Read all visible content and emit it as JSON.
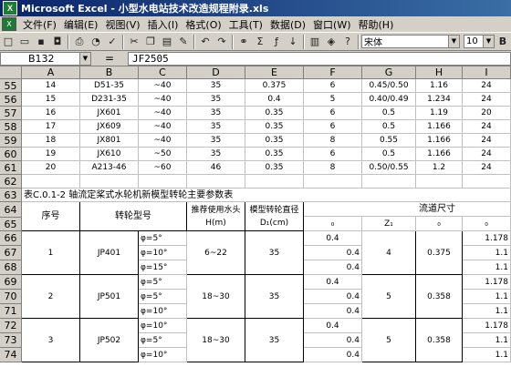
{
  "title": "Microsoft Excel - 小型水电站技术改造规程附录.xls",
  "menu": [
    "文件(F)",
    "编辑(E)",
    "视图(V)",
    "插入(I)",
    "格式(O)",
    "工具(T)",
    "数据(D)",
    "窗口(W)",
    "帮助(H)"
  ],
  "toolbar": {
    "font_name": "宋体",
    "font_size": "10"
  },
  "namebox": "B132",
  "formula_eq": "=",
  "formula_value": "JF2505",
  "columns": [
    "A",
    "B",
    "C",
    "D",
    "E",
    "F",
    "G",
    "H",
    "I"
  ],
  "rows": [
    {
      "n": "55",
      "a": "14",
      "b": "D51-35",
      "c": "~40",
      "d": "35",
      "e": "0.375",
      "f": "6",
      "g": "0.45/0.50",
      "h": "1.16",
      "i": "24"
    },
    {
      "n": "56",
      "a": "15",
      "b": "D231-35",
      "c": "~40",
      "d": "35",
      "e": "0.4",
      "f": "5",
      "g": "0.40/0.49",
      "h": "1.234",
      "i": "24"
    },
    {
      "n": "57",
      "a": "16",
      "b": "JX601",
      "c": "~40",
      "d": "35",
      "e": "0.35",
      "f": "6",
      "g": "0.5",
      "h": "1.19",
      "i": "20"
    },
    {
      "n": "58",
      "a": "17",
      "b": "JX609",
      "c": "~40",
      "d": "35",
      "e": "0.35",
      "f": "6",
      "g": "0.5",
      "h": "1.166",
      "i": "24"
    },
    {
      "n": "59",
      "a": "18",
      "b": "JX801",
      "c": "~40",
      "d": "35",
      "e": "0.35",
      "f": "8",
      "g": "0.55",
      "h": "1.166",
      "i": "24"
    },
    {
      "n": "60",
      "a": "19",
      "b": "JX610",
      "c": "~50",
      "d": "35",
      "e": "0.35",
      "f": "6",
      "g": "0.5",
      "h": "1.166",
      "i": "24"
    },
    {
      "n": "61",
      "a": "20",
      "b": "A213-46",
      "c": "~60",
      "d": "46",
      "e": "0.35",
      "f": "8",
      "g": "0.50/0.55",
      "h": "1.2",
      "i": "24"
    }
  ],
  "row62": "62",
  "row63": {
    "n": "63",
    "text": "表C.0.1-2 轴流定桨式水轮机新模型转轮主要参数表"
  },
  "row64_65": {
    "n1": "64",
    "n2": "65",
    "seq": "序号",
    "model": "转轮型号",
    "head": "推荐使用水头 H(m)",
    "dia": "模型转轮直径D₁(cm)",
    "flow": "流道尺寸",
    "g_sub": "Z₁",
    "e_sub": "₀",
    "h_sub": "₀",
    "i_sub": "₀"
  },
  "groups": [
    {
      "seq": "1",
      "model": "JP401",
      "head": "6~22",
      "dia": "35",
      "z": "4",
      "h": "0.375",
      "rows": [
        {
          "n": "66",
          "c": "φ=5°",
          "e": "0.4",
          "i": "1.178"
        },
        {
          "n": "67",
          "c": "φ=10°",
          "f": "0.4",
          "i": "1.1"
        },
        {
          "n": "68",
          "c": "φ=15°",
          "f": "0.4",
          "i": "1.1"
        }
      ]
    },
    {
      "seq": "2",
      "model": "JP501",
      "head": "18~30",
      "dia": "35",
      "z": "5",
      "h": "0.358",
      "rows": [
        {
          "n": "69",
          "c": "φ=5°",
          "e": "0.4",
          "i": "1.178"
        },
        {
          "n": "70",
          "c": "φ=5°",
          "f": "0.4",
          "i": "1.1"
        },
        {
          "n": "71",
          "c": "φ=10°",
          "f": "0.4",
          "i": "1.1"
        }
      ]
    },
    {
      "seq": "3",
      "model": "JP502",
      "head": "18~30",
      "dia": "35",
      "z": "5",
      "h": "0.358",
      "rows": [
        {
          "n": "72",
          "c": "φ=10°",
          "e": "0.4",
          "i": "1.178"
        },
        {
          "n": "73",
          "c": "φ=5°",
          "f": "0.4",
          "i": "1.1"
        },
        {
          "n": "74",
          "c": "φ=10°",
          "f": "0.4",
          "i": "1.1"
        }
      ]
    }
  ]
}
